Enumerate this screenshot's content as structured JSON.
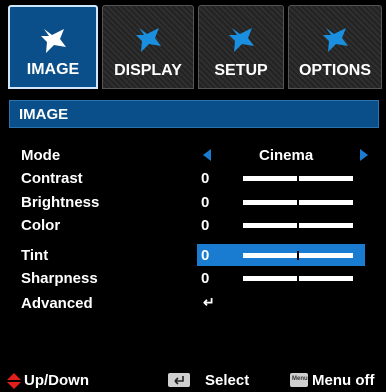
{
  "tabs": [
    {
      "label": "IMAGE",
      "icon": "image-icon",
      "active": true
    },
    {
      "label": "DISPLAY",
      "icon": "display-icon",
      "active": false
    },
    {
      "label": "SETUP",
      "icon": "setup-icon",
      "active": false
    },
    {
      "label": "OPTIONS",
      "icon": "options-icon",
      "active": false
    }
  ],
  "section": {
    "title": "IMAGE"
  },
  "items": [
    {
      "label": "Mode",
      "value": "Cinema"
    },
    {
      "label": "Contrast",
      "value": "0",
      "level": 0.5
    },
    {
      "label": "Brightness",
      "value": "0",
      "level": 0.5
    },
    {
      "label": "Color",
      "value": "0",
      "level": 0.5
    },
    {
      "label": "Tint",
      "value": "0",
      "level": 0.5,
      "selected": true
    },
    {
      "label": "Sharpness",
      "value": "0",
      "level": 0.5
    },
    {
      "label": "Advanced",
      "value": "↵"
    }
  ],
  "footer": {
    "updown": "Up/Down",
    "select": "Select",
    "menu": "Menu off",
    "menu_key": "Menu"
  },
  "colors": {
    "accent": "#0a4f8a",
    "highlight": "#1a7cd0",
    "background": "#000000"
  }
}
